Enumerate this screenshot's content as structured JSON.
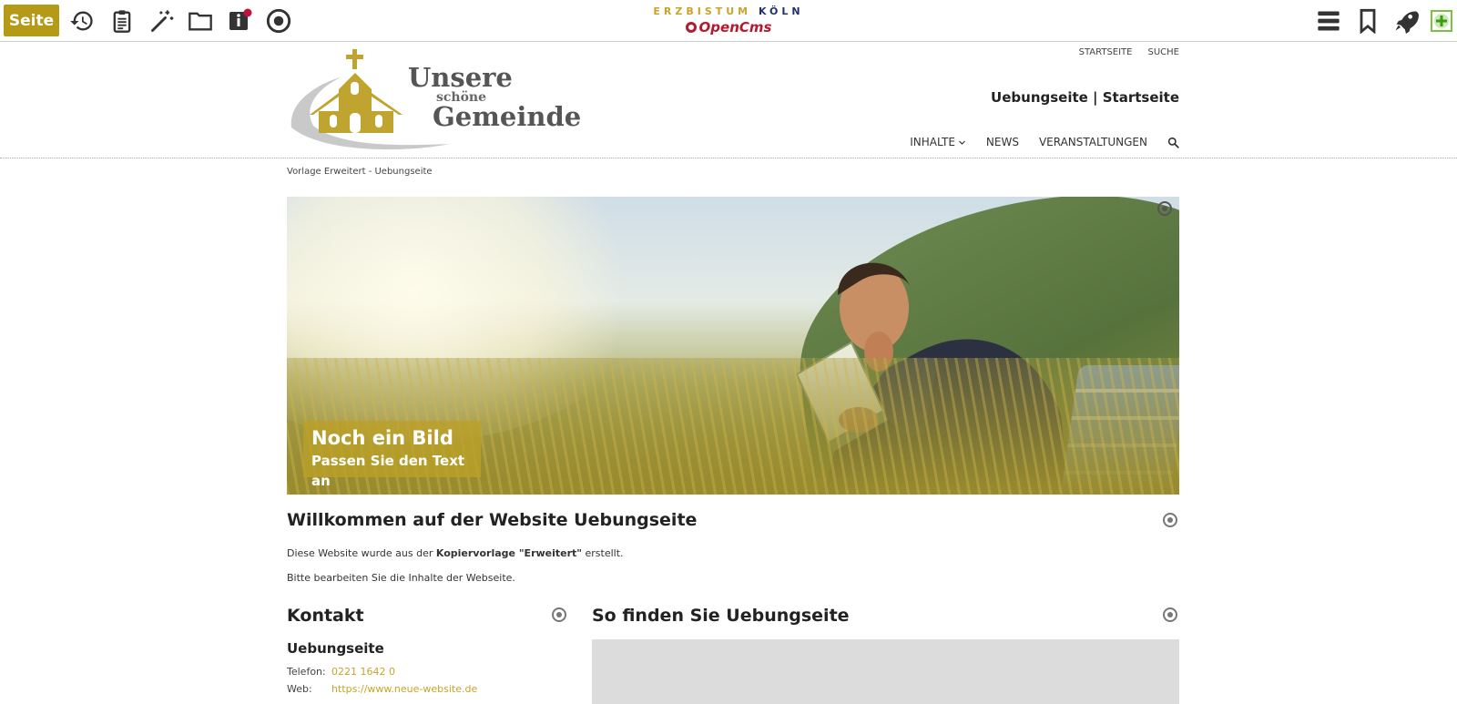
{
  "toolbar": {
    "page_button_label": "Seite",
    "icons": [
      "history-icon",
      "clipboard-icon",
      "magic-wand-icon",
      "folder-icon",
      "info-icon",
      "target-icon",
      "menu-icon",
      "bookmark-icon",
      "rocket-icon",
      "add-element-icon"
    ],
    "brand_line1_a": "ERZBISTUM",
    "brand_line1_b": "KÖLN",
    "brand_line2": "OpenCms"
  },
  "header": {
    "logo_line1": "Unsere",
    "logo_line2": "schöne",
    "logo_line3": "Gemeinde",
    "topnav": [
      "STARTSEITE",
      "SUCHE"
    ],
    "site_title": "Uebungseite | Startseite",
    "mainnav": [
      "INHALTE",
      "NEWS",
      "VERANSTALTUNGEN"
    ]
  },
  "breadcrumb": "Vorlage Erweitert - Uebungseite",
  "hero": {
    "caption_title": "Noch ein Bild",
    "caption_subtitle": "Passen Sie den Text an"
  },
  "welcome": {
    "heading": "Willkommen auf der Website Uebungseite",
    "p1_before": "Diese Website wurde aus der ",
    "p1_bold": "Kopiervorlage \"Erweitert\"",
    "p1_after": " erstellt.",
    "p2": "Bitte bearbeiten Sie die Inhalte der Webseite."
  },
  "kontakt": {
    "heading": "Kontakt",
    "org": "Uebungseite",
    "phone_label": "Telefon:",
    "phone_value": "0221 1642 0",
    "web_label": "Web:",
    "web_value": "https://www.neue-website.de"
  },
  "map": {
    "heading": "So finden Sie Uebungseite"
  },
  "colors": {
    "accent": "#b49a16",
    "link": "#c9a42a",
    "brand_blue": "#21306e",
    "brand_red": "#b21b2f"
  }
}
